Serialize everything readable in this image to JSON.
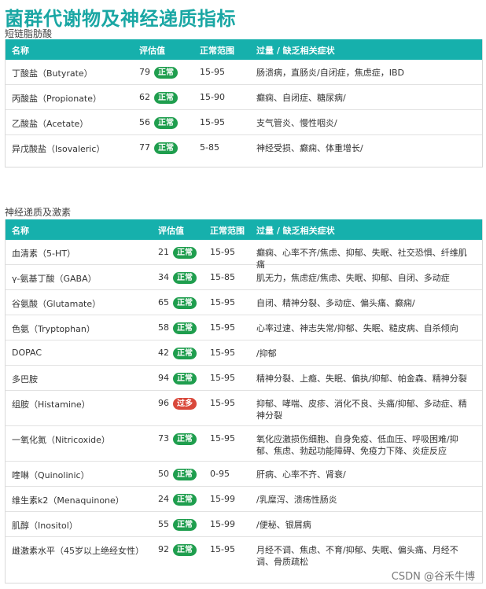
{
  "page_title": "菌群代谢物及神经递质指标",
  "sections": [
    {
      "label": "短链脂肪酸",
      "headers": {
        "name": "名称",
        "score": "评估值",
        "range": "正常范围",
        "symptoms": "过量 / 缺乏相关症状"
      },
      "rows": [
        {
          "name": "丁酸盐（Butyrate）",
          "score": "79",
          "status": "正常",
          "range": "15-95",
          "symptoms": "肠溃病，直肠炎/自闭症，焦虑症，IBD"
        },
        {
          "name": "丙酸盐（Propionate）",
          "score": "62",
          "status": "正常",
          "range": "15-90",
          "symptoms": "癫痫、自闭症、糖尿病/"
        },
        {
          "name": "乙酸盐（Acetate）",
          "score": "56",
          "status": "正常",
          "range": "15-95",
          "symptoms": "支气管炎、慢性咽炎/"
        },
        {
          "name": "异戊酸盐（Isovaleric）",
          "score": "77",
          "status": "正常",
          "range": "5-85",
          "symptoms": "神经受损、癫痫、体重增长/"
        }
      ]
    },
    {
      "label": "神经递质及激素",
      "headers": {
        "name": "名称",
        "score": "评估值",
        "range": "正常范围",
        "symptoms": "过量 / 缺乏相关症状"
      },
      "rows": [
        {
          "name": "血清素（5-HT）",
          "score": "21",
          "status": "正常",
          "range": "15-95",
          "symptoms": "癫痫、心率不齐/焦虑、抑郁、失眠、社交恐惧、纤维肌痛"
        },
        {
          "name": "γ-氨基丁酸（GABA）",
          "score": "34",
          "status": "正常",
          "range": "15-85",
          "symptoms": "肌无力，焦虑症/焦虑、失眠、抑郁、自闭、多动症"
        },
        {
          "name": "谷氨酸（Glutamate）",
          "score": "65",
          "status": "正常",
          "range": "15-95",
          "symptoms": "自闭、精神分裂、多动症、偏头痛、癫痫/"
        },
        {
          "name": "色氨（Tryptophan）",
          "score": "58",
          "status": "正常",
          "range": "15-95",
          "symptoms": "心率过速、神志失常/抑郁、失眠、糙皮病、自杀倾向"
        },
        {
          "name": "DOPAC",
          "score": "42",
          "status": "正常",
          "range": "15-95",
          "symptoms": "/抑郁"
        },
        {
          "name": "多巴胺",
          "score": "94",
          "status": "正常",
          "range": "15-95",
          "symptoms": "精神分裂、上瘾、失眠、偏执/抑郁、帕金森、精神分裂"
        },
        {
          "name": "组胺（Histamine）",
          "score": "96",
          "status": "过多",
          "range": "15-95",
          "symptoms": "抑郁、哮喘、皮疹、消化不良、头痛/抑郁、多动症、精神分裂"
        },
        {
          "name": "一氧化氮（Nitricoxide）",
          "score": "73",
          "status": "正常",
          "range": "15-95",
          "symptoms": "氧化应激损伤细胞、自身免疫、低血压、呼吸困难/抑郁、焦虑、勃起功能障碍、免疫力下降、炎症反应"
        },
        {
          "name": "喹啉（Quinolinic）",
          "score": "50",
          "status": "正常",
          "range": "0-95",
          "symptoms": "肝病、心率不齐、肾衰/"
        },
        {
          "name": "维生素k2（Menaquinone）",
          "score": "24",
          "status": "正常",
          "range": "15-99",
          "symptoms": "/乳糜泻、溃疡性肠炎"
        },
        {
          "name": "肌醇（Inositol）",
          "score": "55",
          "status": "正常",
          "range": "15-99",
          "symptoms": "/便秘、银屑病"
        },
        {
          "name": "雌激素水平（45岁以上绝经女性）",
          "score": "92",
          "status": "正常",
          "range": "15-95",
          "symptoms": "月经不调、焦虑、不育/抑郁、失眠、偏头痛、月经不调、骨质疏松"
        }
      ]
    }
  ],
  "watermark": "CSDN @谷禾牛博",
  "colors": {
    "accent": "#16b0ac",
    "title": "#1aa7a4",
    "normal_badge": "#1f9e4e",
    "over_badge": "#d9483b"
  }
}
